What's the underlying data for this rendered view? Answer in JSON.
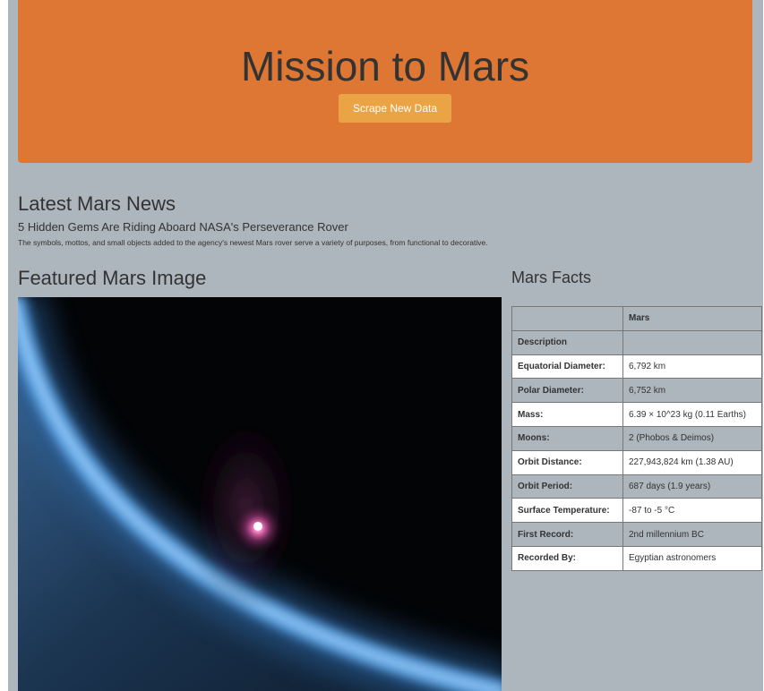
{
  "colors": {
    "page_bg": "#adb5bd",
    "jumbotron_bg": "#dd7733",
    "button_bg": "#eba445",
    "heading_text": "#333333"
  },
  "header": {
    "title": "Mission to Mars",
    "scrape_button": "Scrape New Data"
  },
  "news": {
    "heading": "Latest Mars News",
    "title": "5 Hidden Gems Are Riding Aboard NASA's Perseverance Rover",
    "paragraph": "The symbols, mottos, and small objects added to the agency's newest Mars rover serve a variety of purposes, from functional to decorative."
  },
  "featured": {
    "heading": "Featured Mars Image"
  },
  "facts": {
    "heading": "Mars Facts",
    "columns": [
      "",
      "Mars"
    ],
    "rows": [
      {
        "label": "Description",
        "value": ""
      },
      {
        "label": "Equatorial Diameter:",
        "value": "6,792 km"
      },
      {
        "label": "Polar Diameter:",
        "value": "6,752 km"
      },
      {
        "label": "Mass:",
        "value": "6.39 × 10^23 kg (0.11 Earths)"
      },
      {
        "label": "Moons:",
        "value": "2 (Phobos & Deimos)"
      },
      {
        "label": "Orbit Distance:",
        "value": "227,943,824 km (1.38 AU)"
      },
      {
        "label": "Orbit Period:",
        "value": "687 days (1.9 years)"
      },
      {
        "label": "Surface Temperature:",
        "value": "-87 to -5 °C"
      },
      {
        "label": "First Record:",
        "value": "2nd millennium BC"
      },
      {
        "label": "Recorded By:",
        "value": "Egyptian astronomers"
      }
    ]
  }
}
